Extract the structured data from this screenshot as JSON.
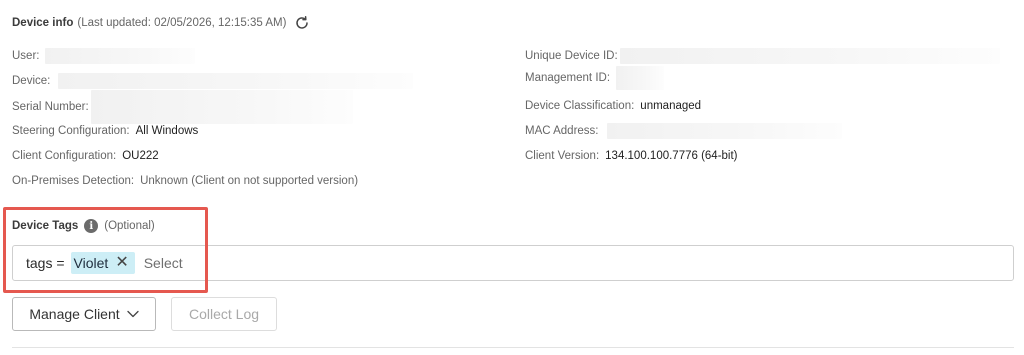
{
  "header": {
    "title": "Device info",
    "updated": "(Last updated: 02/05/2026, 12:15:35 AM)",
    "refresh_icon": "refresh-icon"
  },
  "left_fields": [
    {
      "label": "User:",
      "value": ""
    },
    {
      "label": "Device:",
      "value": ""
    },
    {
      "label": "Serial Number:",
      "value": ""
    },
    {
      "label": "Steering Configuration:",
      "value": "All Windows"
    },
    {
      "label": "Client Configuration:",
      "value": "OU222"
    },
    {
      "label": "On-Premises Detection:",
      "value": "Unknown (Client on not supported version)"
    }
  ],
  "right_fields": [
    {
      "label": "Unique Device ID:",
      "value": ""
    },
    {
      "label": "Management ID:",
      "value": ""
    },
    {
      "label": "Device Classification:",
      "value": "unmanaged"
    },
    {
      "label": "MAC Address:",
      "value": ""
    },
    {
      "label": "Client Version:",
      "value": "134.100.100.7776 (64-bit)"
    }
  ],
  "tags": {
    "label": "Device Tags",
    "optional": "(Optional)",
    "info_icon": "info-icon",
    "prefix": "tags =",
    "chips": [
      {
        "label": "Violet"
      }
    ],
    "placeholder": "Select"
  },
  "actions": {
    "manage_label": "Manage Client",
    "collect_label": "Collect Log"
  },
  "colors": {
    "highlight": "#e5584f",
    "chip_bg": "#cdeef6"
  }
}
